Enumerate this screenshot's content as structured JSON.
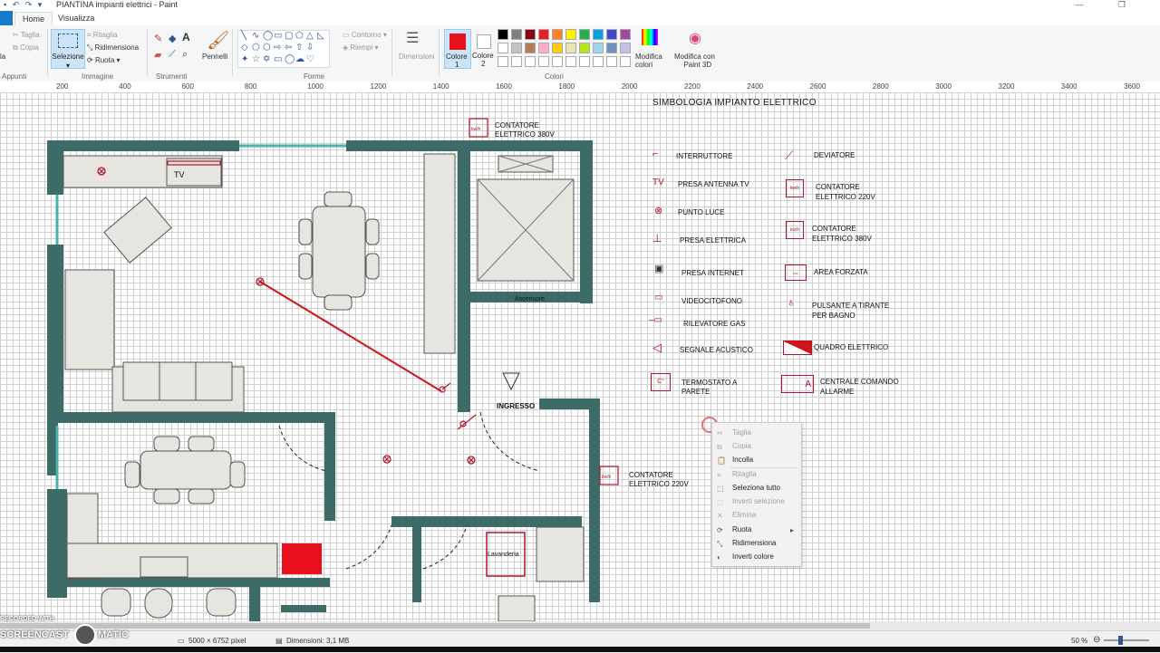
{
  "window": {
    "title": "PIANTINA impianti elettrici - Paint"
  },
  "tabs": [
    "Home",
    "Visualizza"
  ],
  "ribbon": {
    "clipboard": {
      "paste": "la",
      "cut": "Taglia",
      "copy": "Copia",
      "group": "Appunti"
    },
    "image": {
      "select": "Selezione",
      "crop": "Ritaglia",
      "resize": "Ridimensiona",
      "rotate": "Ruota",
      "group": "Immagine"
    },
    "tools": {
      "group": "Strumenti",
      "text_tool": "A"
    },
    "brushes": {
      "label": "Pennelli"
    },
    "shapes": {
      "group": "Forme",
      "outline": "Contorno",
      "fill": "Riempi"
    },
    "size": {
      "label": "Dimensioni"
    },
    "colors": {
      "color1_label": "Colore",
      "color1_num": "1",
      "color2_label": "Colore",
      "color2_num": "2",
      "edit": "Modifica",
      "edit2": "colori",
      "paint3d": "Modifica con",
      "paint3d2": "Paint 3D",
      "group": "Colori",
      "color1": "#e8101c",
      "color2": "#ffffff"
    },
    "palette": [
      "#000000",
      "#7f7f7f",
      "#880015",
      "#ed1c24",
      "#ff7f27",
      "#fff200",
      "#22b14c",
      "#00a2e8",
      "#3f48cc",
      "#a349a4",
      "#ffffff",
      "#c3c3c3",
      "#b97a57",
      "#ffaec9",
      "#ffc90e",
      "#efe4b0",
      "#b5e61d",
      "#99d9ea",
      "#7092be",
      "#c8bfe7"
    ]
  },
  "ruler": [
    "200",
    "400",
    "600",
    "800",
    "1000",
    "1200",
    "1400",
    "1600",
    "1800",
    "2000",
    "2200",
    "2400",
    "2600",
    "2800",
    "3000",
    "3200",
    "3400",
    "3600"
  ],
  "legend": {
    "title": "SIMBOLOGIA IMPIANTO ELETTRICO",
    "left": [
      "INTERRUTTORE",
      "PRESA ANTENNA TV",
      "PUNTO LUCE",
      "PRESA ELETTRICA",
      "PRESA INTERNET",
      "VIDEOCITOFONO",
      "RILEVATORE GAS",
      "SEGNALE ACUSTICO",
      "TERMOSTATO A",
      "PARETE"
    ],
    "right": [
      "DEVIATORE",
      "CONTATORE",
      "ELETTRICO 220V",
      "CONTATORE",
      "ELETTRICO 380V",
      "AREA FORZATA",
      "PULSANTE A TIRANTE",
      "PER BAGNO",
      "QUADRO ELETTRICO",
      "CENTRALE COMANDO",
      "ALLARME"
    ]
  },
  "plan": {
    "tv": "TV",
    "elevator": "Ascensore",
    "entrance": "INGRESSO",
    "laundry": "Lavanderia",
    "meter_top1": "CONTATORE",
    "meter_top2": "ELETTRICO 380V",
    "meter_mid1": "CONTATORE",
    "meter_mid2": "ELETTRICO 220V",
    "kwh": "kw/h",
    "celsius": "C°",
    "alarm": "A"
  },
  "context_menu": [
    "Taglia",
    "Copia",
    "Incolla",
    "Ritaglia",
    "Seleziona tutto",
    "Inverti selezione",
    "Elimina",
    "Ruota",
    "Ridimensiona",
    "Inverti colore"
  ],
  "status": {
    "size": "5000 × 6752 pixel",
    "filesize": "Dimensioni: 3,1 MB",
    "zoom": "50 %"
  },
  "watermark": {
    "line1": "RECORDED WITH",
    "line2": "SCREENCAST",
    "line3": "MATIC"
  }
}
